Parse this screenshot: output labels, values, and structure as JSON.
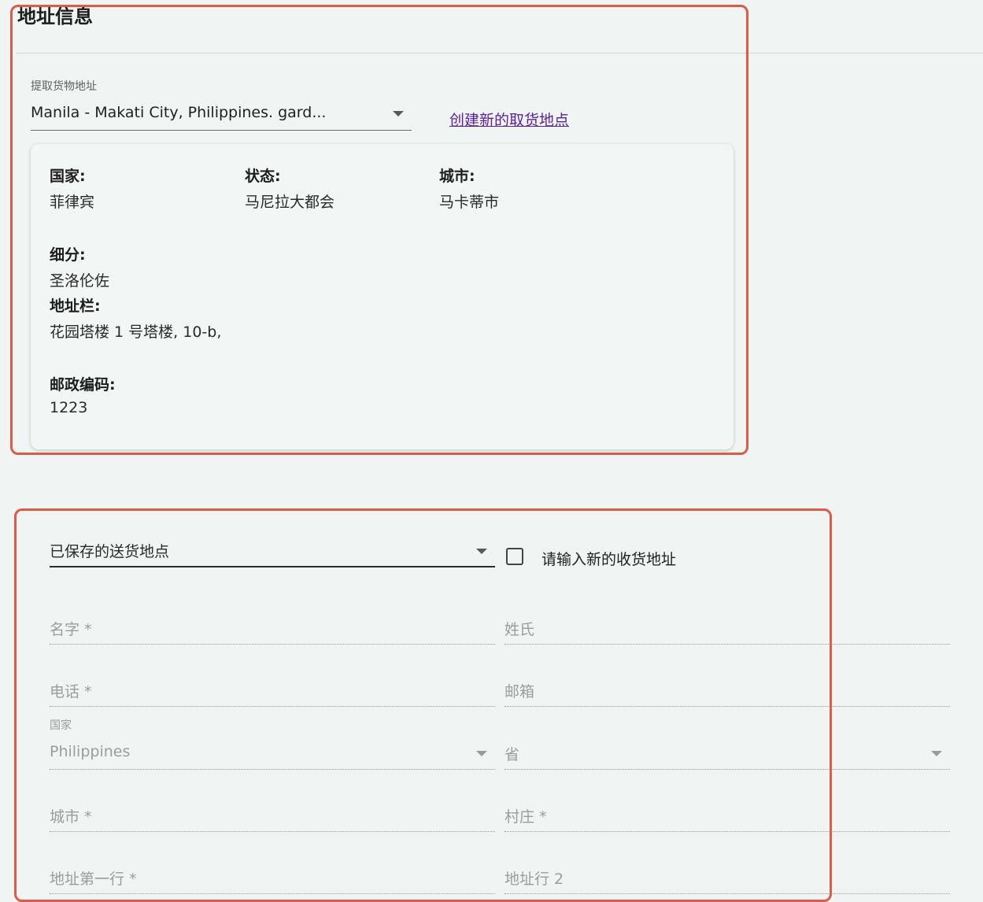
{
  "pickup_section": {
    "title": "地址信息",
    "pickup_label": "提取货物地址",
    "pickup_value": "Manila - Makati City, Philippines. gard...",
    "create_link": "创建新的取货地点",
    "card": {
      "country_label": "国家:",
      "country_value": "菲律宾",
      "state_label": "状态:",
      "state_value": "马尼拉大都会",
      "city_label": "城市:",
      "city_value": "马卡蒂市",
      "subdivision_label": "细分:",
      "subdivision_value": "圣洛伦佐",
      "address_label": "地址栏:",
      "address_value": "花园塔楼 1 号塔楼, 10-b,",
      "postal_label": "邮政编码:",
      "postal_value": "1223"
    }
  },
  "delivery_section": {
    "saved_select": "已保存的送货地点",
    "new_address_checkbox": "请输入新的收货地址",
    "new_address_checked": false,
    "fields": {
      "first_name": "名字 *",
      "last_name": "姓氏",
      "phone": "电话 *",
      "email": "邮箱",
      "country_label": "国家",
      "country_value": "Philippines",
      "province": "省",
      "city": "城市 *",
      "village": "村庄 *",
      "address1": "地址第一行 *",
      "address2": "地址行 2"
    }
  },
  "colors": {
    "background": "#f0f5f3",
    "highlight_outline": "#e05a4a",
    "link": "#5a21a8"
  },
  "icons": {
    "dropdown": "chevron-down-icon",
    "checkbox": "checkbox-unchecked-icon"
  }
}
